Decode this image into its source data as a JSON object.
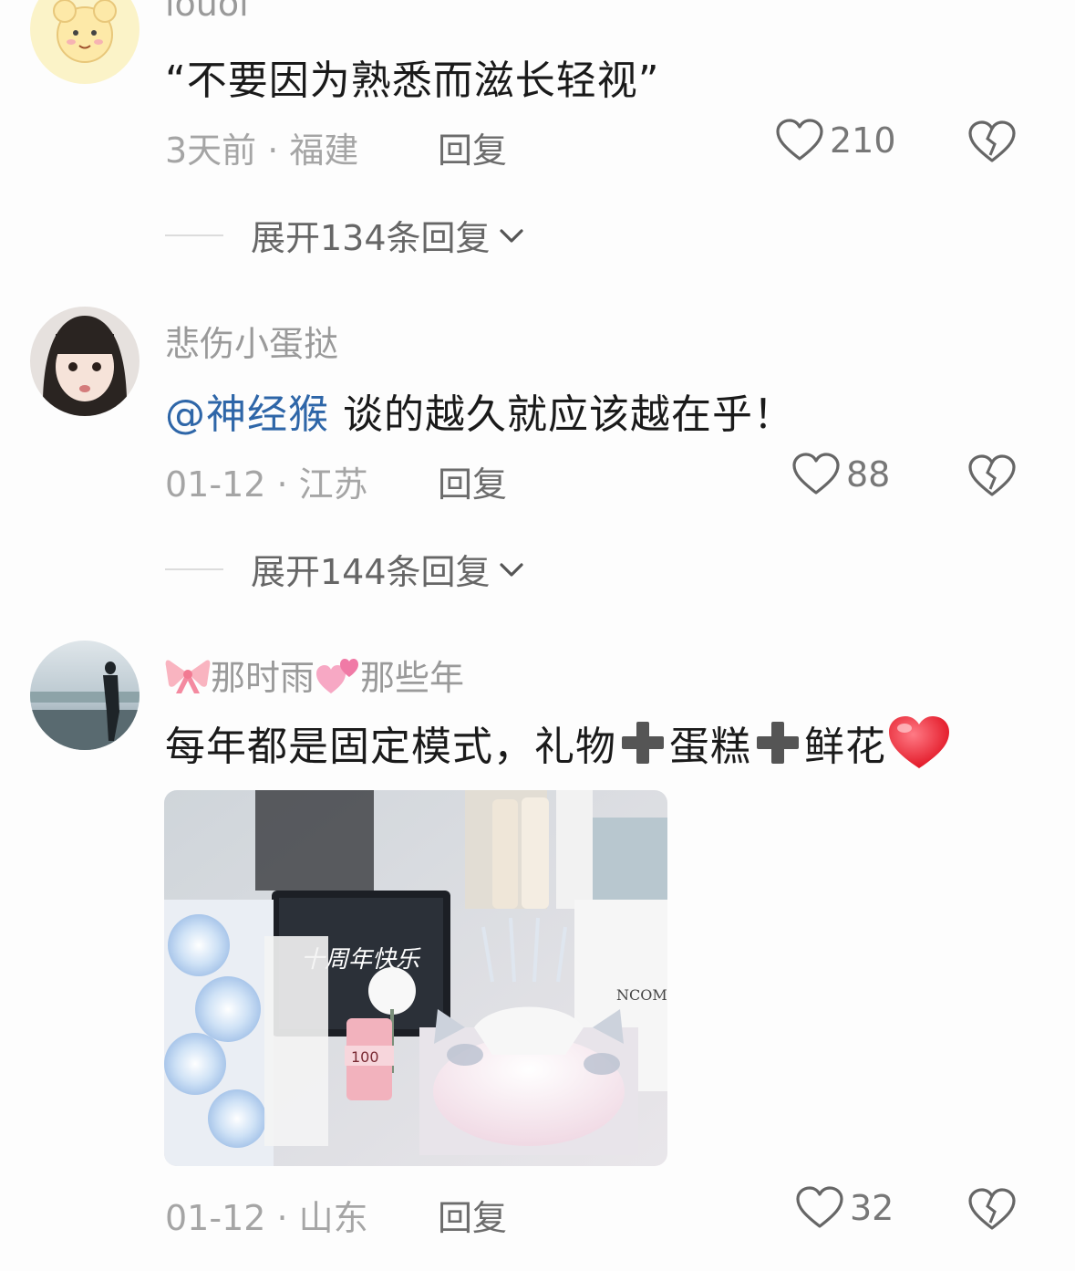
{
  "comments": [
    {
      "username": "louol",
      "content": "“不要因为熟悉而滋长轻视”",
      "meta": "3天前 · 福建",
      "reply_label": "回复",
      "likes": "210",
      "expand_label": "展开134条回复"
    },
    {
      "username": "悲伤小蛋挞",
      "mention": "@神经猴",
      "content": " 谈的越久就应该越在乎！",
      "meta": "01-12 · 江苏",
      "reply_label": "回复",
      "likes": "88",
      "expand_label": "展开144条回复"
    },
    {
      "username_parts": [
        "那时雨",
        "那些年"
      ],
      "content_parts": [
        "每年都是固定模式，礼物",
        "蛋糕",
        "鲜花"
      ],
      "photo_text": [
        "十周年快乐",
        "100",
        "NCOME"
      ],
      "meta": "01-12 · 山东",
      "reply_label": "回复",
      "likes": "32"
    }
  ],
  "icons": {
    "like": "heart-outline-icon",
    "dislike": "broken-heart-icon",
    "expand": "chevron-down-icon",
    "plus": "plus-emoji-icon",
    "bow": "ribbon-bow-emoji-icon",
    "hearts": "two-hearts-emoji-icon",
    "heart": "red-heart-emoji-icon"
  },
  "colors": {
    "mention": "#2e66a8",
    "meta": "#a5a5a5",
    "username": "#9a9a9a"
  }
}
